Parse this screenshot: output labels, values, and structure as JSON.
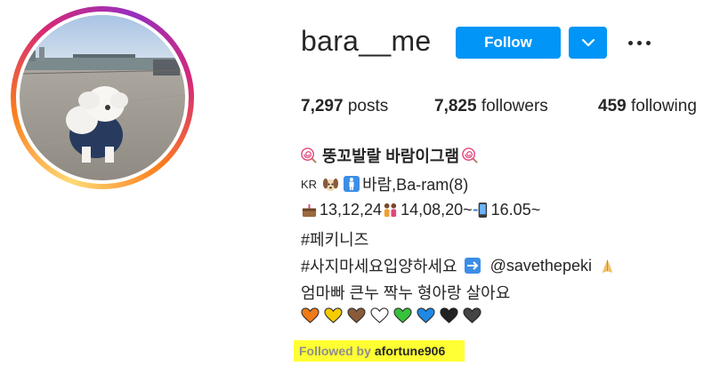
{
  "profile": {
    "username": "bara__me",
    "follow_label": "Follow",
    "stats": {
      "posts_count": "7,297",
      "posts_label": "posts",
      "followers_count": "7,825",
      "followers_label": "followers",
      "following_count": "459",
      "following_label": "following"
    },
    "full_name": "뚱꼬발랄 바람이그램",
    "bio": {
      "line1_kr": "KR",
      "line1_text": "바람,Ba-ram(8)",
      "line2_a": "13,12,24",
      "line2_b": "14,08,20~",
      "line2_c": "16.05~",
      "line3": "#페키니즈",
      "line4_a": "#사지마세요입양하세요",
      "line4_mention": "@savethepeki",
      "line5": "엄마빠 큰누 짝누 형아랑 살아요"
    },
    "followed_by": {
      "label": "Followed by",
      "user": "afortune906"
    }
  },
  "colors": {
    "accent": "#0095f6",
    "highlight": "#ffff33",
    "hearts": [
      "#f07a18",
      "#f5cc00",
      "#8a5a3a",
      "#ffffff",
      "#36c13a",
      "#1e88e5",
      "#222222",
      "#444444"
    ]
  },
  "icons": [
    "lollipop-icon",
    "dog-face-icon",
    "mens-room-icon",
    "cake-icon",
    "family-icon",
    "mobile-phone-icon",
    "right-arrow-icon",
    "folded-hands-icon",
    "heart-icon",
    "chevron-down-icon",
    "more-options-icon"
  ]
}
